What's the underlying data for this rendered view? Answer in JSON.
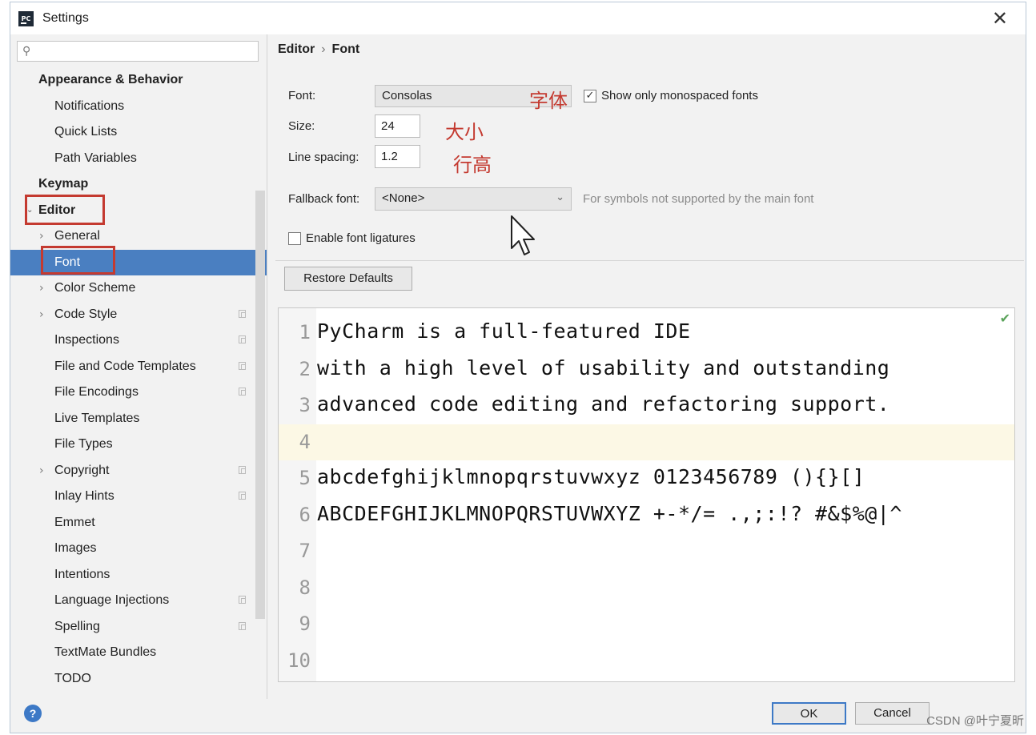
{
  "window": {
    "title": "Settings",
    "app_icon_text": "PC"
  },
  "search": {
    "placeholder": "",
    "value": ""
  },
  "sidebar": {
    "items": [
      {
        "label": "Appearance & Behavior",
        "bold": true
      },
      {
        "label": "Notifications"
      },
      {
        "label": "Quick Lists"
      },
      {
        "label": "Path Variables"
      },
      {
        "label": "Keymap",
        "bold": true
      },
      {
        "label": "Editor",
        "bold": true,
        "expanded": true
      },
      {
        "label": "General",
        "expandable": true
      },
      {
        "label": "Font",
        "selected": true
      },
      {
        "label": "Color Scheme",
        "expandable": true
      },
      {
        "label": "Code Style",
        "expandable": true,
        "project_icon": true
      },
      {
        "label": "Inspections",
        "project_icon": true
      },
      {
        "label": "File and Code Templates",
        "project_icon": true
      },
      {
        "label": "File Encodings",
        "project_icon": true
      },
      {
        "label": "Live Templates"
      },
      {
        "label": "File Types"
      },
      {
        "label": "Copyright",
        "expandable": true,
        "project_icon": true
      },
      {
        "label": "Inlay Hints",
        "project_icon": true
      },
      {
        "label": "Emmet"
      },
      {
        "label": "Images"
      },
      {
        "label": "Intentions"
      },
      {
        "label": "Language Injections",
        "project_icon": true
      },
      {
        "label": "Spelling",
        "project_icon": true
      },
      {
        "label": "TextMate Bundles"
      },
      {
        "label": "TODO"
      }
    ]
  },
  "breadcrumb": {
    "parent": "Editor",
    "separator": "›",
    "current": "Font"
  },
  "form": {
    "font_label": "Font:",
    "font_value": "Consolas",
    "font_annotation": "字体",
    "mono_checkbox_checked": true,
    "mono_checkbox_label": "Show only monospaced fonts",
    "size_label": "Size:",
    "size_value": "24",
    "size_annotation": "大小",
    "line_spacing_label": "Line spacing:",
    "line_spacing_value": "1.2",
    "line_spacing_annotation": "行高",
    "fallback_label": "Fallback font:",
    "fallback_value": "<None>",
    "fallback_hint": "For symbols not supported by the main font",
    "ligatures_checked": false,
    "ligatures_label": "Enable font ligatures",
    "restore_label": "Restore Defaults"
  },
  "preview": {
    "lines": [
      {
        "num": "1",
        "text": "PyCharm is a full-featured IDE"
      },
      {
        "num": "2",
        "text": "with a high level of usability and outstanding"
      },
      {
        "num": "3",
        "text": "advanced code editing and refactoring support."
      },
      {
        "num": "4",
        "text": ""
      },
      {
        "num": "5",
        "text": "abcdefghijklmnopqrstuvwxyz 0123456789 (){}[]"
      },
      {
        "num": "6",
        "text": "ABCDEFGHIJKLMNOPQRSTUVWXYZ +-*/= .,;:!? #&$%@|^"
      },
      {
        "num": "7",
        "text": ""
      },
      {
        "num": "8",
        "text": ""
      },
      {
        "num": "9",
        "text": ""
      },
      {
        "num": "10",
        "text": ""
      }
    ],
    "current_line": "4"
  },
  "footer": {
    "ok_label": "OK",
    "cancel_label": "Cancel",
    "help_label": "?"
  },
  "watermark": "CSDN @叶宁夏昕",
  "colors": {
    "selection": "#4a7fc1",
    "annotation": "#c43a30",
    "current_line": "#fcf8e5"
  }
}
